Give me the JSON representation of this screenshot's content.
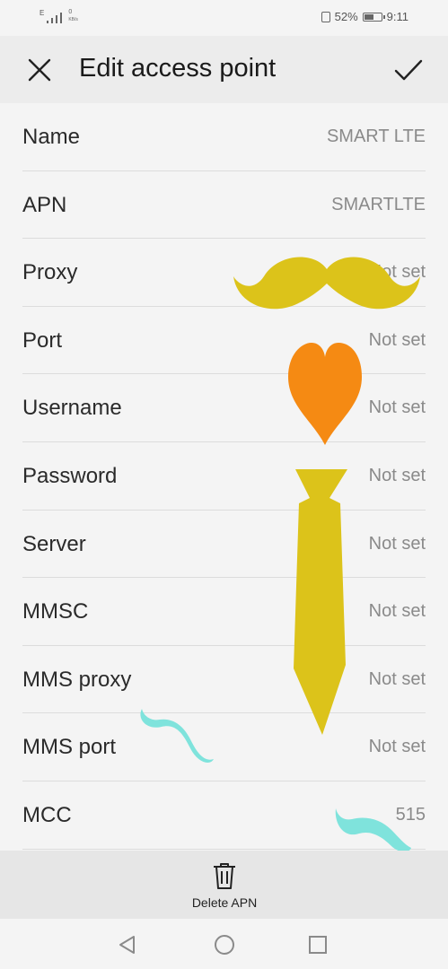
{
  "status_bar": {
    "network_type": "E",
    "speed": "0",
    "speed_unit": "KB/s",
    "battery": "52%",
    "time": "9:11"
  },
  "header": {
    "title": "Edit access point"
  },
  "fields": [
    {
      "label": "Name",
      "value": "SMART LTE"
    },
    {
      "label": "APN",
      "value": "SMARTLTE"
    },
    {
      "label": "Proxy",
      "value": "Not set"
    },
    {
      "label": "Port",
      "value": "Not set"
    },
    {
      "label": "Username",
      "value": "Not set"
    },
    {
      "label": "Password",
      "value": "Not set"
    },
    {
      "label": "Server",
      "value": "Not set"
    },
    {
      "label": "MMSC",
      "value": "Not set"
    },
    {
      "label": "MMS proxy",
      "value": "Not set"
    },
    {
      "label": "MMS port",
      "value": "Not set"
    },
    {
      "label": "MCC",
      "value": "515"
    }
  ],
  "bottom_bar": {
    "delete_label": "Delete APN"
  },
  "icons": {
    "close": "close-icon",
    "confirm": "check-icon",
    "delete": "trash-icon",
    "back": "nav-back-icon",
    "home": "nav-home-icon",
    "recents": "nav-recents-icon"
  },
  "colors": {
    "background": "#f4f4f4",
    "app_bar": "#ececec",
    "sticker_yellow": "#dcc31a",
    "sticker_orange": "#f58a13",
    "sticker_cyan": "#7fe3dc"
  }
}
